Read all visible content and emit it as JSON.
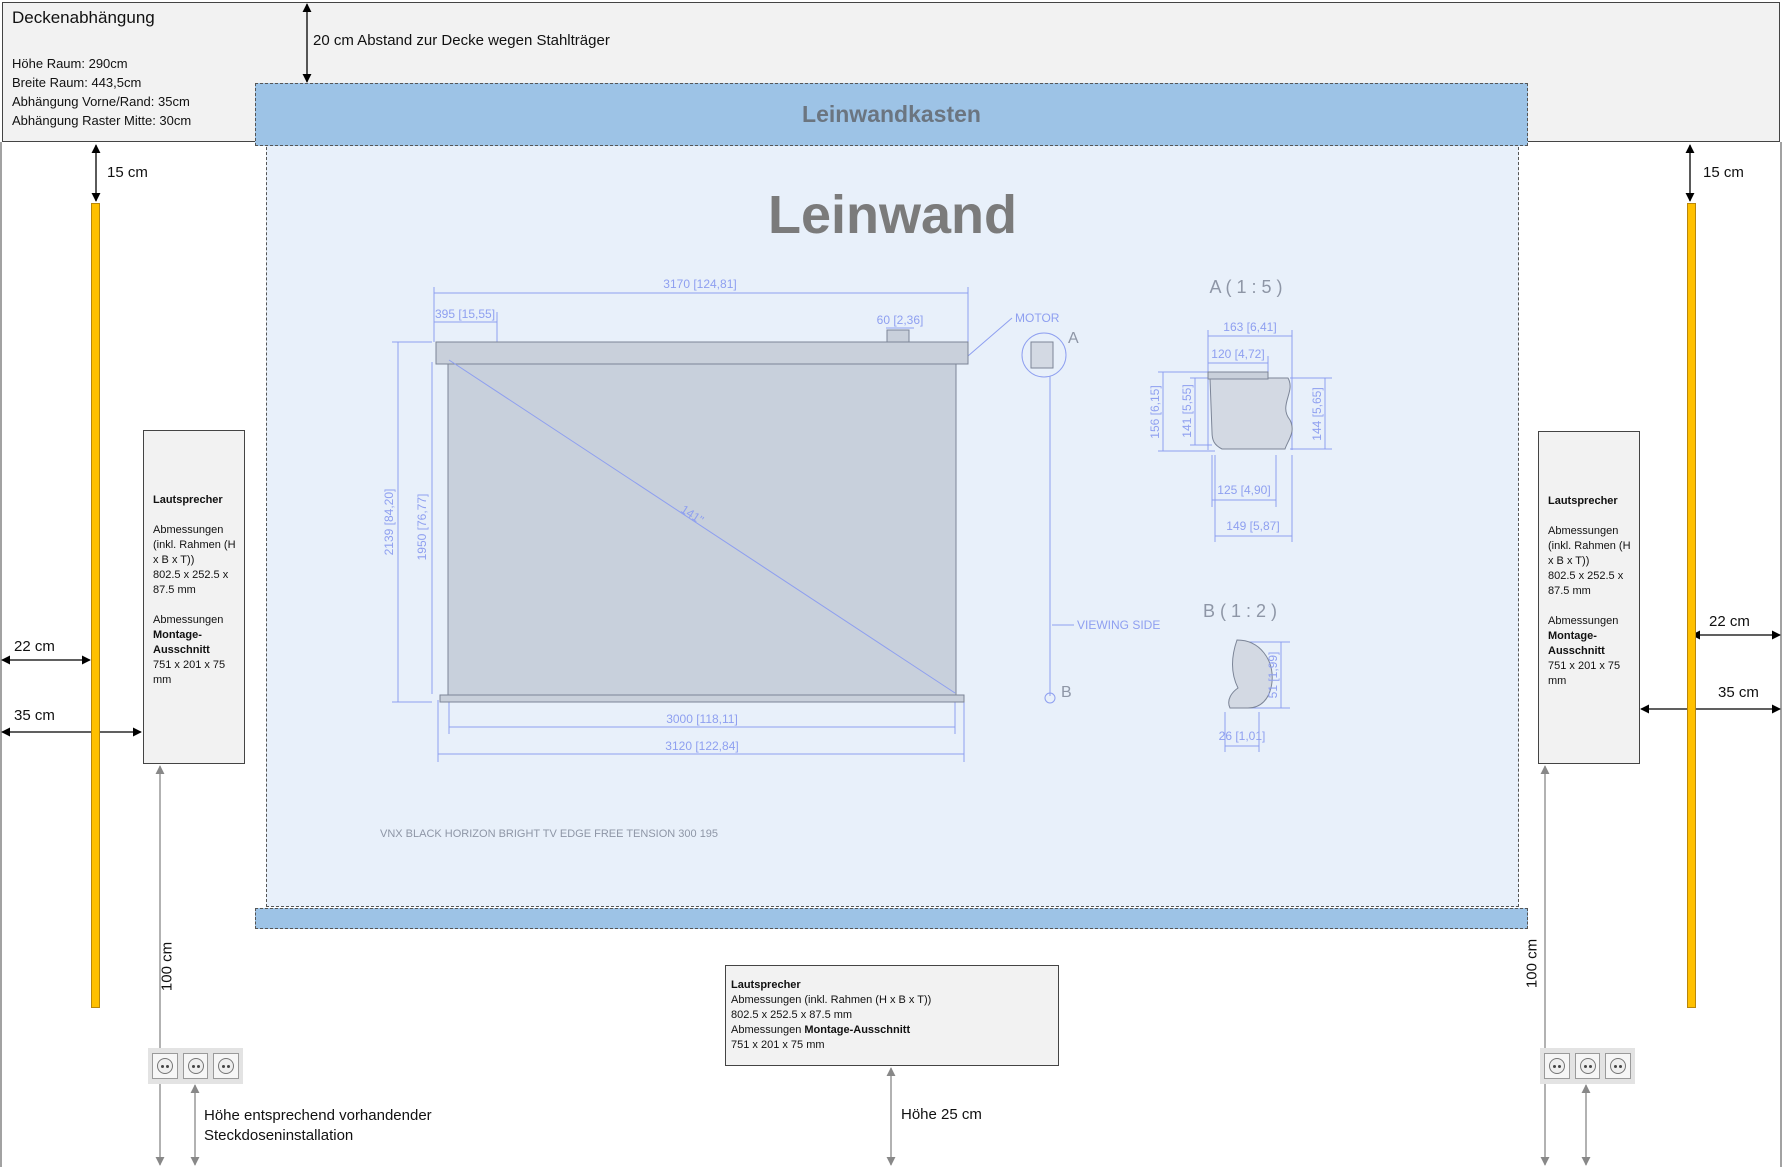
{
  "ceiling": {
    "title": "Deckenabhängung",
    "lines": [
      "Höhe Raum: 290cm",
      "Breite Raum: 443,5cm",
      "Abhängung Vorne/Rand: 35cm",
      "Abhängung Raster Mitte: 30cm"
    ]
  },
  "annotations": {
    "ceiling_gap": "20 cm Abstand zur Decke wegen Stahlträger",
    "top_left_gap": "15 cm",
    "top_right_gap": "15 cm",
    "left_22": "22 cm",
    "left_35": "35 cm",
    "right_22": "22 cm",
    "right_35": "35 cm",
    "left_100": "100 cm",
    "right_100": "100 cm",
    "socket_height": "Höhe entsprechend vorhandender Steckdoseninstallation",
    "bottom_height": "Höhe 25 cm"
  },
  "screen_box": {
    "label": "Leinwandkasten"
  },
  "screen": {
    "title": "Leinwand"
  },
  "drawing": {
    "dims": {
      "total_width": "3170 [124,81]",
      "left_offset": "395 [15,55]",
      "motor_width": "60 [2,36]",
      "motor": "MOTOR",
      "a": "A",
      "b": "B",
      "height_total": "2139 [84,20]",
      "height_view": "1950 [76,77]",
      "diagonal": "141\"",
      "view_width": "3000 [118,11]",
      "outer_width": "3120 [122,84]",
      "viewing_side": "VIEWING SIDE"
    },
    "detail_a": {
      "title": "A ( 1 : 5 )",
      "w163": "163 [6,41]",
      "w120": "120 [4,72]",
      "h156": "156 [6,15]",
      "h141": "141 [5,55]",
      "h144": "144 [5,65]",
      "w125": "125 [4,90]",
      "w149": "149 [5,87]"
    },
    "detail_b": {
      "title": "B ( 1 : 2 )",
      "h51": "51 [1,99]",
      "w26": "26 [1,01]"
    },
    "model": "VNX BLACK HORIZON BRIGHT TV EDGE FREE TENSION 300 195"
  },
  "speaker_left": {
    "title": "Lautsprecher",
    "dims_label": "Abmessungen (inkl. Rahmen (H x B x T))",
    "dims_value": "802.5 x 252.5 x 87.5 mm",
    "cut_label": "Abmessungen",
    "cut_bold": "Montage-Ausschnitt",
    "cut_value": "751 x 201 x 75 mm"
  },
  "speaker_right": {
    "title": "Lautsprecher",
    "dims_label": "Abmessungen (inkl. Rahmen (H x B x T))",
    "dims_value": "802.5 x 252.5 x 87.5 mm",
    "cut_label": "Abmessungen",
    "cut_bold": "Montage-Ausschnitt",
    "cut_value": "751 x 201 x 75 mm"
  },
  "speaker_bottom": {
    "title": "Lautsprecher",
    "dims_line": "Abmessungen (inkl. Rahmen (H x B x T))",
    "dims_value": "802.5 x 252.5 x 87.5 mm",
    "cut_label": "Abmessungen",
    "cut_bold": "Montage-Ausschnitt",
    "cut_value": "751 x 201 x 75 mm"
  }
}
